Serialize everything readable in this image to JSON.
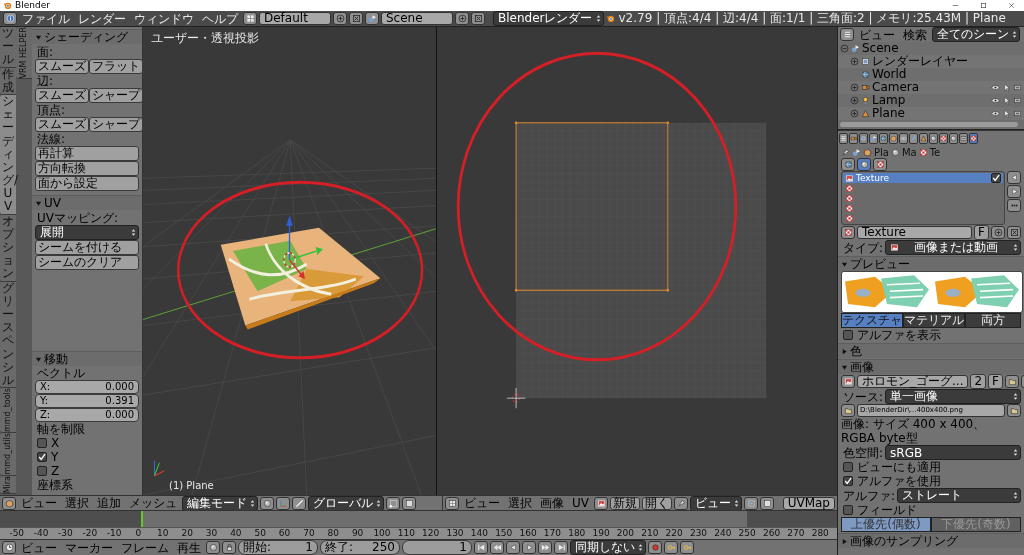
{
  "window": {
    "title": "Blender"
  },
  "menubar": {
    "menus": [
      "ファイル",
      "レンダー",
      "ウィンドウ",
      "ヘルプ"
    ],
    "layout": "Default",
    "scene": "Scene",
    "engine": "Blenderレンダー",
    "stats": "v2.79 | 頂点:4/4 | 辺:4/4 | 面:1/1 | 三角面:2 | メモリ:25.43M | Plane"
  },
  "tool_tabs": [
    {
      "label": "ツール",
      "kind": "stacked",
      "selected": false
    },
    {
      "label": "作成",
      "kind": "stacked",
      "selected": false
    },
    {
      "label": "シェーディング/UV",
      "kind": "stacked",
      "selected": true
    },
    {
      "label": "オプション",
      "kind": "stacked",
      "selected": false
    },
    {
      "label": "グリースペンシル",
      "kind": "stacked",
      "selected": false
    },
    {
      "label": "mmd_tools",
      "kind": "rotated",
      "selected": false
    },
    {
      "label": "mmd_utils",
      "kind": "rotated",
      "selected": false
    },
    {
      "label": "Mira",
      "kind": "rotated",
      "selected": false
    },
    {
      "label": "VRM HELPER",
      "kind": "rotated",
      "selected": false
    }
  ],
  "tool_panel": {
    "sections": [
      {
        "title": "シェーディング",
        "expanded": true,
        "groups": [
          {
            "label": "面:",
            "kind": "pair",
            "buttons": [
              "スムーズ",
              "フラット"
            ]
          },
          {
            "label": "辺:",
            "kind": "pair",
            "buttons": [
              "スムーズ",
              "シャープ"
            ]
          },
          {
            "label": "頂点:",
            "kind": "pair",
            "buttons": [
              "スムーズ",
              "シャープ"
            ]
          },
          {
            "label": "法線:",
            "kind": "stack",
            "buttons": [
              "再計算",
              "方向転換",
              "面から設定"
            ]
          }
        ]
      },
      {
        "title": "UV",
        "expanded": true,
        "groups": [
          {
            "label": "UVマッピング:",
            "kind": "menu",
            "dropdown": "展開",
            "buttons": [
              "シームを付ける",
              "シームのクリア"
            ]
          }
        ]
      }
    ]
  },
  "operator": {
    "title": "移動",
    "expanded": true,
    "vector_label": "ベクトル",
    "fields": [
      {
        "label": "X:",
        "value": "0.000"
      },
      {
        "label": "Y:",
        "value": "0.391"
      },
      {
        "label": "Z:",
        "value": "0.000"
      }
    ],
    "constraint_label": "軸を制限",
    "axes": [
      {
        "label": "X",
        "checked": false
      },
      {
        "label": "Y",
        "checked": true
      },
      {
        "label": "Z",
        "checked": false
      }
    ],
    "next_label": "座標系"
  },
  "viewport_3d": {
    "view_label": "ユーザー・透視投影",
    "object_label": "(1) Plane"
  },
  "outliner": {
    "menus": [
      "ビュー",
      "検索"
    ],
    "filter": "全てのシーン",
    "tree": [
      {
        "label": "Scene",
        "kind": "scene",
        "expanded": true,
        "children": [
          {
            "label": "レンダーレイヤー",
            "kind": "layers",
            "expanded": false
          },
          {
            "label": "World",
            "kind": "world"
          },
          {
            "label": "Camera",
            "kind": "camera",
            "expanded": false
          },
          {
            "label": "Lamp",
            "kind": "lamp",
            "expanded": false
          },
          {
            "label": "Plane",
            "kind": "mesh",
            "expanded": false
          }
        ]
      }
    ]
  },
  "properties": {
    "context_tabs": [
      {
        "selected": false
      },
      {
        "selected": false
      },
      {
        "selected": false
      },
      {
        "selected": false
      },
      {
        "selected": false
      },
      {
        "selected": false
      },
      {
        "selected": false
      },
      {
        "selected": false
      },
      {
        "selected": false
      },
      {
        "selected": false
      },
      {
        "selected": false
      },
      {
        "selected": false
      },
      {
        "selected": true
      }
    ],
    "breadcrumb": [
      "Pla",
      "Ma",
      "Te"
    ],
    "texture_context": [
      {
        "selected": false
      },
      {
        "selected": true
      },
      {
        "selected": false
      }
    ],
    "slots": [
      {
        "name": "Texture",
        "selected": true,
        "enabled": true
      },
      {
        "selected": false
      },
      {
        "selected": false
      },
      {
        "selected": false
      },
      {
        "selected": false
      }
    ],
    "texture_name": "Texture",
    "fake_user": "F",
    "type_label": "タイプ:",
    "type_value": "画像または動画",
    "preview": {
      "title": "プレビュー",
      "expanded": true,
      "tabs": [
        {
          "label": "テクスチャ",
          "selected": true
        },
        {
          "label": "マテリアル",
          "selected": false
        },
        {
          "label": "両方",
          "selected": false
        }
      ],
      "show_alpha": {
        "label": "アルファを表示",
        "checked": false
      }
    },
    "color_panel": {
      "title": "色",
      "expanded": false
    },
    "image_panel": {
      "title": "画像",
      "expanded": true,
      "image_name": "ホロモン_ゴーグ...",
      "users": "2",
      "fake_user": "F",
      "source_label": "ソース:",
      "source": "単一画像",
      "filepath": "D:\\BlenderDir\\...400x400.png",
      "info": "画像: サイズ 400 x 400、 RGBA byte型",
      "colorspace_label": "色空間:",
      "colorspace": "sRGB",
      "options": [
        {
          "label": "ビューにも適用",
          "checked": false
        },
        {
          "label": "アルファを使用",
          "checked": true
        }
      ],
      "alpha_label": "アルファ:",
      "alpha": "ストレート",
      "fields": {
        "label": "フィールド",
        "checked": false
      },
      "field_order": [
        {
          "label": "上優先(偶数)",
          "selected": true
        },
        {
          "label": "下優先(奇数)",
          "selected": false
        }
      ]
    },
    "sampling_panel": {
      "title": "画像のサンプリング",
      "expanded": false
    }
  },
  "view3d_header": {
    "menus": [
      "ビュー",
      "選択",
      "追加",
      "メッシュ"
    ],
    "mode": "編集モード",
    "orientation": "グローバル"
  },
  "uv_header": {
    "menus": [
      "ビュー",
      "選択",
      "画像",
      "UV"
    ],
    "new": "新規",
    "open": "開く",
    "view": "ビュー",
    "uv_map": "UVMap"
  },
  "timeline": {
    "ticks": [
      "-50",
      "-40",
      "-30",
      "-20",
      "-10",
      "0",
      "10",
      "20",
      "30",
      "40",
      "50",
      "60",
      "70",
      "80",
      "90",
      "100",
      "110",
      "120",
      "130",
      "140",
      "150",
      "160",
      "170",
      "180",
      "190",
      "200",
      "210",
      "220",
      "230",
      "240",
      "250",
      "260",
      "270",
      "280"
    ],
    "menus": [
      "ビュー",
      "マーカー",
      "フレーム",
      "再生"
    ],
    "start": {
      "label": "開始:",
      "value": "1"
    },
    "end": {
      "label": "終了:",
      "value": "250"
    },
    "current": "1",
    "sync": "同期しない"
  }
}
